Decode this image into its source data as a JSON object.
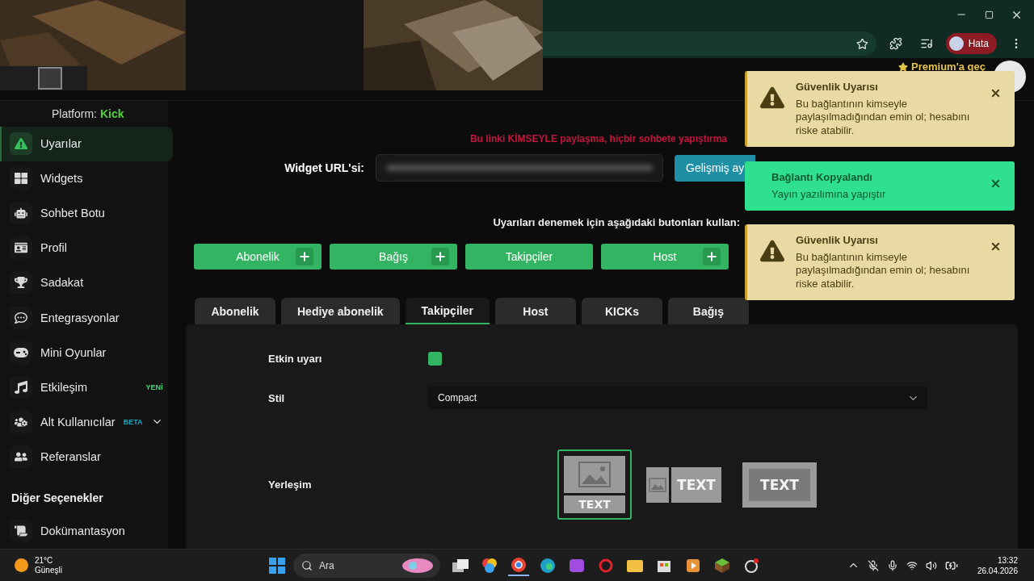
{
  "browser": {
    "profile": "Hata"
  },
  "header": {
    "premium": "Premium'a geç"
  },
  "sidebar": {
    "platform_label": "Platform:",
    "platform": "Kick",
    "items": [
      {
        "label": "Uyarılar",
        "selected": true,
        "kind": "link"
      },
      {
        "label": "Widgets",
        "selected": false,
        "kind": "link"
      },
      {
        "label": "Sohbet Botu",
        "selected": false,
        "kind": "link"
      },
      {
        "label": "Profil",
        "selected": false,
        "kind": "link"
      },
      {
        "label": "Sadakat",
        "selected": false,
        "kind": "link"
      },
      {
        "label": "Entegrasyonlar",
        "selected": false,
        "kind": "link"
      },
      {
        "label": "Mini Oyunlar",
        "selected": false,
        "kind": "link"
      },
      {
        "label": "Etkileşim",
        "selected": false,
        "kind": "link",
        "badge": {
          "text": "YENİ",
          "color": "#3ddc6e"
        }
      },
      {
        "label": "Alt Kullanıcılar",
        "selected": false,
        "kind": "group",
        "badge": {
          "text": "BETA",
          "color": "#1fa9c0"
        }
      },
      {
        "label": "Referanslar",
        "selected": false,
        "kind": "link"
      }
    ],
    "section": "Diğer Seçenekler",
    "more_items": [
      {
        "label": "Dokümantasyon",
        "selected": false
      }
    ]
  },
  "main": {
    "warning": "Bu linki KİMSEYLE paylaşma, hiçbir sohbete yapıştırma",
    "url_label": "Widget URL'si:",
    "advanced_button": "Gelişmiş ay",
    "test_hint": "Uyarıları denemek için aşağıdaki butonları kullan:",
    "test_buttons": [
      {
        "label": "Abonelik",
        "plus": true
      },
      {
        "label": "Bağış",
        "plus": true
      },
      {
        "label": "Takipçiler",
        "plus": false
      },
      {
        "label": "Host",
        "plus": true
      }
    ],
    "tabs": [
      {
        "label": "Abonelik",
        "selected": false
      },
      {
        "label": "Hediye abonelik",
        "selected": false
      },
      {
        "label": "Takipçiler",
        "selected": true
      },
      {
        "label": "Host",
        "selected": false
      },
      {
        "label": "KICKs",
        "selected": false
      },
      {
        "label": "Bağış",
        "selected": false
      }
    ],
    "settings": {
      "enabled_label": "Etkin uyarı",
      "enabled": true,
      "style_label": "Stil",
      "style_value": "Compact",
      "layout_label": "Yerleşim",
      "layouts": [
        {
          "kind": "stacked",
          "selected": true,
          "caption": "TEXT"
        },
        {
          "kind": "side",
          "selected": false,
          "caption": "TEXT"
        },
        {
          "kind": "overlay",
          "selected": false,
          "caption": "TEXT"
        }
      ]
    }
  },
  "toasts": [
    {
      "kind": "warning",
      "title": "Güvenlik Uyarısı",
      "message": "Bu bağlantının kimseyle paylaşılmadığından emin ol; hesabını riske atabilir."
    },
    {
      "kind": "success",
      "title": "Bağlantı Kopyalandı",
      "message": "Yayın yazılımına yapıştır"
    },
    {
      "kind": "warning",
      "title": "Güvenlik Uyarısı",
      "message": "Bu bağlantının kimseyle paylaşılmadığından emin ol; hesabını riske atabilir."
    }
  ],
  "taskbar": {
    "temperature": "21°C",
    "weather": "Güneşli",
    "search_placeholder": "Ara",
    "time": "13:32",
    "date": "26.04.2026"
  }
}
